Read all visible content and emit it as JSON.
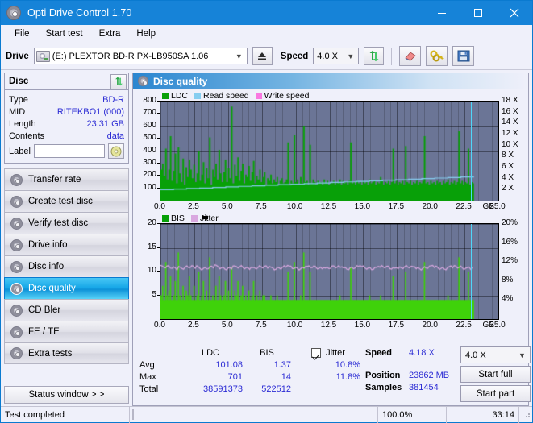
{
  "window": {
    "title": "Opti Drive Control 1.70",
    "icon": "disc-icon",
    "minimize": "minimize-icon",
    "maximize": "maximize-icon",
    "close": "close-icon"
  },
  "menubar": {
    "items": [
      {
        "label": "File"
      },
      {
        "label": "Start test"
      },
      {
        "label": "Extra"
      },
      {
        "label": "Help"
      }
    ]
  },
  "toolbar": {
    "drive_label": "Drive",
    "drive_value": "(E:)  PLEXTOR BD-R  PX-LB950SA 1.06",
    "eject_icon": "eject-icon",
    "speed_label": "Speed",
    "speed_value": "4.0 X",
    "refresh_icon": "refresh-arrows-icon",
    "eraser_icon": "eraser-icon",
    "keys_icon": "keys-icon",
    "save_icon": "floppy-save-icon"
  },
  "disc_panel": {
    "title": "Disc",
    "refresh_icon": "refresh-arrows-icon",
    "rows": [
      {
        "key": "Type",
        "value": "BD-R"
      },
      {
        "key": "MID",
        "value": "RITEKBO1 (000)"
      },
      {
        "key": "Length",
        "value": "23.31 GB"
      },
      {
        "key": "Contents",
        "value": "data"
      }
    ],
    "label_key": "Label",
    "label_value": "",
    "label_placeholder": "",
    "cd_icon": "cd-disc-icon"
  },
  "sidebar": {
    "items": [
      {
        "label": "Transfer rate",
        "active": false
      },
      {
        "label": "Create test disc",
        "active": false
      },
      {
        "label": "Verify test disc",
        "active": false
      },
      {
        "label": "Drive info",
        "active": false
      },
      {
        "label": "Disc info",
        "active": false
      },
      {
        "label": "Disc quality",
        "active": true
      },
      {
        "label": "CD Bler",
        "active": false
      },
      {
        "label": "FE / TE",
        "active": false
      },
      {
        "label": "Extra tests",
        "active": false
      }
    ],
    "status_button": "Status window > >"
  },
  "panel": {
    "title": "Disc quality",
    "icon": "disc-quality-icon"
  },
  "chart_data": [
    {
      "type": "area",
      "id": "ldc-chart",
      "title": "",
      "xlabel": "GB",
      "ylabel": "",
      "legend": [
        {
          "label": "LDC",
          "color": "#08a008"
        },
        {
          "label": "Read speed",
          "color": "#86cdf0"
        },
        {
          "label": "Write speed",
          "color": "#f978e0"
        }
      ],
      "legend_position": "top-left",
      "grid": true,
      "x": [
        0.0,
        2.5,
        5.0,
        7.5,
        10.0,
        12.5,
        15.0,
        17.5,
        20.0,
        22.5,
        25.0
      ],
      "xlim": [
        0.0,
        25.0
      ],
      "xticks": [
        "0.0",
        "2.5",
        "5.0",
        "7.5",
        "10.0",
        "12.5",
        "15.0",
        "17.5",
        "20.0",
        "22.5",
        "25.0"
      ],
      "xunit": "GB",
      "ylim": [
        0,
        800
      ],
      "yticks": [
        100,
        200,
        300,
        400,
        500,
        600,
        700,
        800
      ],
      "y2lim": [
        0,
        18
      ],
      "y2ticks": [
        "2 X",
        "4 X",
        "6 X",
        "8 X",
        "10 X",
        "12 X",
        "14 X",
        "16 X",
        "18 X"
      ],
      "series": [
        {
          "name": "LDC",
          "color": "#08a008",
          "values": [
            250,
            300,
            200,
            420,
            170,
            250,
            520,
            160,
            240,
            380,
            140,
            430,
            220,
            150,
            340,
            130,
            270,
            190,
            330,
            250,
            180,
            290,
            150,
            220,
            400,
            160,
            210,
            310,
            140,
            260,
            180,
            510,
            130,
            250,
            190,
            300,
            170,
            410,
            220,
            150,
            230,
            330,
            150,
            260,
            180,
            760,
            140,
            290,
            200,
            350,
            160,
            240,
            300,
            140,
            210,
            190,
            280,
            160,
            230,
            320,
            140,
            200,
            170,
            250,
            150,
            190,
            230,
            130,
            180,
            160,
            210,
            140,
            170,
            150,
            190,
            130,
            160,
            180,
            140,
            150,
            170,
            470,
            130,
            160,
            140,
            530,
            150,
            170,
            130,
            190,
            140,
            600,
            150,
            160,
            130,
            450,
            140,
            170,
            150,
            130,
            160,
            140,
            150,
            130,
            170,
            140,
            160,
            130,
            150,
            140,
            160,
            130,
            150,
            140,
            170,
            130,
            160,
            140,
            150,
            130,
            160,
            470,
            140,
            150,
            130,
            160,
            140,
            150,
            130,
            160,
            140,
            150,
            130,
            170,
            140,
            150,
            160,
            130,
            150,
            140,
            190,
            160,
            130,
            150,
            140,
            160,
            130,
            150,
            420,
            140,
            160,
            130,
            150,
            140,
            160,
            130,
            440,
            150,
            140,
            160,
            130,
            150,
            140,
            160,
            130,
            150,
            140,
            160,
            520,
            140,
            150,
            130,
            160,
            140,
            150,
            130,
            160,
            140,
            150,
            130,
            160,
            140,
            150,
            170,
            130,
            150,
            140,
            160,
            130,
            150,
            560,
            140,
            160,
            130,
            150,
            140,
            420,
            130,
            150,
            140
          ]
        },
        {
          "name": "Read speed",
          "color": "#86cdf0",
          "note": "rises from ~2.0X to ~4.3X across the disc",
          "values_x": [
            2.0,
            2.1,
            2.2,
            2.3,
            2.4,
            2.5,
            2.6,
            2.7,
            2.8,
            2.9,
            3.0,
            3.1,
            3.2,
            3.3,
            3.4,
            3.5,
            3.6,
            3.7,
            3.8,
            3.9,
            4.0,
            4.1,
            4.2,
            4.3
          ]
        }
      ],
      "data_end_x": 23.2,
      "cursor_x": 23.0
    },
    {
      "type": "bar",
      "id": "bis-chart",
      "title": "",
      "xlabel": "GB",
      "legend": [
        {
          "label": "BIS",
          "color": "#08a008"
        },
        {
          "label": "Jitter",
          "color": "#d9a8e0"
        }
      ],
      "legend_position": "top-left",
      "grid": true,
      "xlim": [
        0.0,
        25.0
      ],
      "xticks": [
        "0.0",
        "2.5",
        "5.0",
        "7.5",
        "10.0",
        "12.5",
        "15.0",
        "17.5",
        "20.0",
        "22.5",
        "25.0"
      ],
      "xunit": "GB",
      "ylim": [
        0,
        20
      ],
      "yticks": [
        5,
        10,
        15,
        20
      ],
      "y2lim": [
        0,
        20
      ],
      "y2ticks": [
        "4%",
        "8%",
        "12%",
        "16%",
        "20%"
      ],
      "series": [
        {
          "name": "BIS",
          "color": "#3fd20a",
          "values": [
            5,
            7,
            4,
            12,
            5,
            6,
            9,
            4,
            5,
            8,
            4,
            14,
            5,
            4,
            7,
            4,
            6,
            5,
            9,
            5,
            4,
            7,
            4,
            5,
            10,
            4,
            5,
            8,
            4,
            6,
            4,
            13,
            4,
            5,
            4,
            7,
            4,
            9,
            5,
            4,
            5,
            8,
            4,
            6,
            4,
            11,
            4,
            6,
            5,
            8,
            4,
            5,
            7,
            4,
            5,
            4,
            6,
            4,
            5,
            8,
            4,
            5,
            4,
            6,
            4,
            5,
            5,
            4,
            4,
            4,
            5,
            4,
            4,
            4,
            5,
            4,
            4,
            4,
            4,
            4,
            4,
            10,
            4,
            4,
            4,
            12,
            4,
            4,
            4,
            5,
            4,
            14,
            4,
            4,
            4,
            10,
            4,
            4,
            4,
            4,
            4,
            4,
            4,
            4,
            4,
            4,
            4,
            4,
            4,
            4,
            4,
            4,
            4,
            4,
            5,
            4,
            4,
            4,
            4,
            4,
            4,
            11,
            4,
            4,
            4,
            4,
            4,
            4,
            4,
            4,
            4,
            4,
            4,
            5,
            4,
            4,
            4,
            4,
            4,
            4,
            5,
            4,
            4,
            4,
            4,
            4,
            4,
            4,
            9,
            4,
            4,
            4,
            4,
            4,
            4,
            4,
            10,
            4,
            4,
            4,
            4,
            4,
            4,
            4,
            4,
            4,
            4,
            4,
            12,
            4,
            4,
            4,
            4,
            4,
            4,
            4,
            4,
            4,
            4,
            4,
            4,
            4,
            4,
            5,
            4,
            4,
            4,
            4,
            4,
            4,
            13,
            4,
            4,
            4,
            4,
            4,
            10,
            4,
            4,
            4
          ]
        },
        {
          "name": "Jitter",
          "color": "#d9a8e0",
          "note": "roughly flat near 10.8%",
          "avg": 10.8,
          "max": 11.8
        }
      ],
      "data_end_x": 23.2,
      "cursor_x": 23.0
    }
  ],
  "stats": {
    "columns": [
      "",
      "LDC",
      "BIS",
      "Jitter"
    ],
    "jitter_checked": true,
    "jitter_label": "Jitter",
    "rows": [
      {
        "label": "Avg",
        "ldc": "101.08",
        "bis": "1.37",
        "jitter": "10.8%"
      },
      {
        "label": "Max",
        "ldc": "701",
        "bis": "14",
        "jitter": "11.8%"
      },
      {
        "label": "Total",
        "ldc": "38591373",
        "bis": "522512",
        "jitter": ""
      }
    ]
  },
  "run_info": {
    "speed_label": "Speed",
    "speed_value": "4.18 X",
    "position_label": "Position",
    "position_value": "23862 MB",
    "samples_label": "Samples",
    "samples_value": "381454",
    "speed_select": "4.0 X",
    "start_full": "Start full",
    "start_part": "Start part"
  },
  "statusbar": {
    "message": "Test completed",
    "progress_percent": 100.0,
    "progress_text": "100.0%",
    "elapsed": "33:14"
  },
  "colors": {
    "titlebar": "#1683d8",
    "accent_blue": "#2b2bd4",
    "plot_bg": "#6b7596",
    "green": "#08a008",
    "bright_green": "#3fd20a",
    "read_speed": "#86cdf0",
    "write_speed": "#f978e0",
    "jitter": "#d9a8e0",
    "cursor": "#4fd6f8",
    "progress": "#16a116"
  }
}
